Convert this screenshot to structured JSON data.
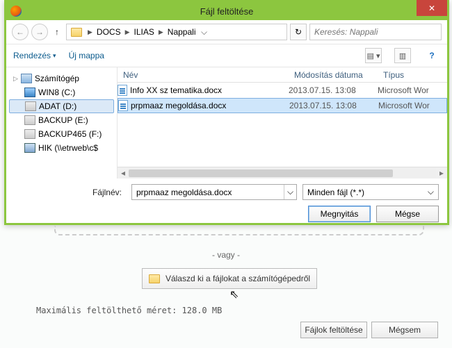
{
  "dialog": {
    "title": "Fájl feltöltése",
    "close_glyph": "✕"
  },
  "nav": {
    "back_glyph": "←",
    "fwd_glyph": "→",
    "up_glyph": "↑",
    "refresh_glyph": "↻",
    "breadcrumb": [
      "DOCS",
      "ILIAS",
      "Nappali"
    ],
    "search_placeholder": "Keresés: Nappali"
  },
  "toolbar": {
    "organize": "Rendezés",
    "new_folder": "Új mappa",
    "help_glyph": "?"
  },
  "tree": {
    "root": "Számítógép",
    "items": [
      {
        "label": "WIN8 (C:)",
        "icon": "win8"
      },
      {
        "label": "ADAT (D:)",
        "icon": "drive",
        "selected": true
      },
      {
        "label": "BACKUP (E:)",
        "icon": "drive"
      },
      {
        "label": "BACKUP465 (F:)",
        "icon": "drive"
      },
      {
        "label": "HIK (\\\\etrweb\\c$",
        "icon": "net"
      }
    ]
  },
  "columns": {
    "name": "Név",
    "date": "Módosítás dátuma",
    "type": "Típus"
  },
  "files": [
    {
      "name": "Info XX sz tematika.docx",
      "date": "2013.07.15. 13:08",
      "type": "Microsoft Wor"
    },
    {
      "name": "prpmaaz megoldása.docx",
      "date": "2013.07.15. 13:08",
      "type": "Microsoft Wor",
      "selected": true
    }
  ],
  "filename": {
    "label": "Fájlnév:",
    "value": "prpmaaz megoldása.docx",
    "filter": "Minden fájl (*.*)"
  },
  "dialog_buttons": {
    "open": "Megnyitás",
    "cancel": "Mégse"
  },
  "page": {
    "or": "- vagy -",
    "pick": "Válaszd ki a fájlokat a számítógépedről",
    "max": "Maximális feltölthető méret: 128.0 MB",
    "upload": "Fájlok feltöltése",
    "cancel": "Mégsem"
  }
}
